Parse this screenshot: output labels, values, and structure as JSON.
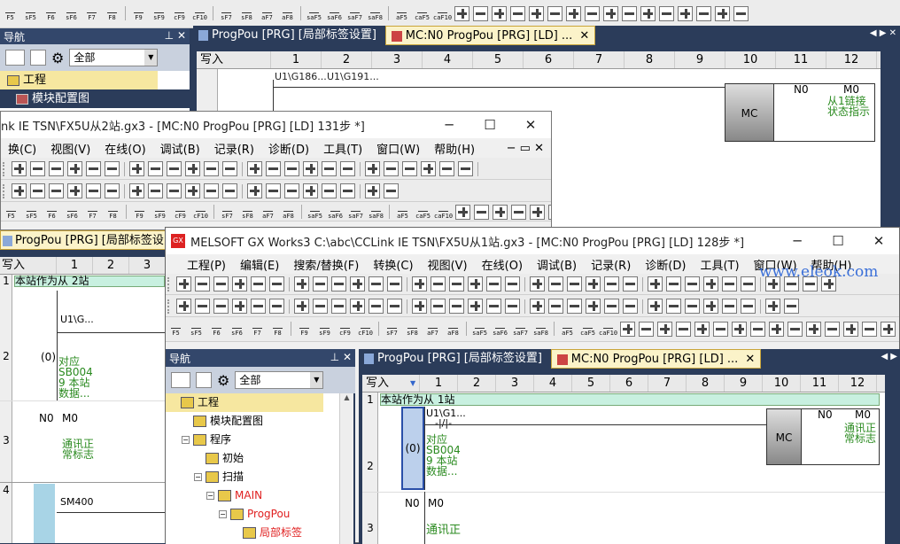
{
  "top_toolbar": {
    "labels": [
      "F5",
      "sF5",
      "F6",
      "sF6",
      "F7",
      "F8",
      "F9",
      "sF9",
      "cF9",
      "cF10",
      "sF7",
      "sF8",
      "aF7",
      "aF8",
      "saF5",
      "saF6",
      "saF7",
      "saF8",
      "aF5",
      "caF5",
      "caF10"
    ]
  },
  "back_nav": {
    "title": "导航",
    "select_value": "全部",
    "tree": [
      "工程",
      "模块配置图"
    ]
  },
  "back_tabs": [
    "ProgPou [PRG] [局部标签设置]",
    "MC:N0 ProgPou [PRG] [LD] ..."
  ],
  "back_ladder": {
    "write_mode": "写入",
    "columns": [
      "1",
      "2",
      "3",
      "4",
      "5",
      "6",
      "7",
      "8",
      "9",
      "10",
      "11",
      "12"
    ],
    "contacts": [
      "U1\\G186...",
      "U1\\G191..."
    ],
    "mc": "MC",
    "n0": "N0",
    "m0": "M0",
    "m0_comment": "从1链接\n状态指示",
    "row1": "1"
  },
  "mid_window": {
    "title": "nk IE TSN\\FX5U从2站.gx3 - [MC:N0 ProgPou [PRG] [LD] 131步 *]",
    "menus": [
      "换(C)",
      "视图(V)",
      "在线(O)",
      "调试(B)",
      "记录(R)",
      "诊断(D)",
      "工具(T)",
      "窗口(W)",
      "帮助(H)"
    ],
    "tab": "ProgPou [PRG] [局部标签设",
    "ladder": {
      "write_mode": "写入",
      "columns": [
        "1",
        "2",
        "3"
      ],
      "row1": "1",
      "row1_comment": "本站作为从 2站",
      "row2": "2",
      "step0": "(0)",
      "contact": "U1\\G...",
      "comment_row2": "对应\nSB004\n9 本站\n数据...",
      "row3": "3",
      "n0": "N0",
      "m0": "M0",
      "comment_row3": "通讯正\n常标志",
      "row4": "4",
      "sm400": "SM400"
    }
  },
  "front_window": {
    "title": "MELSOFT GX Works3 C:\\abc\\CCLink IE TSN\\FX5U从1站.gx3 - [MC:N0 ProgPou [PRG] [LD] 128步 *]",
    "menus": [
      "工程(P)",
      "编辑(E)",
      "搜索/替换(F)",
      "转换(C)",
      "视图(V)",
      "在线(O)",
      "调试(B)",
      "记录(R)",
      "诊断(D)",
      "工具(T)",
      "窗口(W)",
      "帮助(H)"
    ],
    "watermark": "www.eleok.com",
    "nav": {
      "title": "导航",
      "select_value": "全部",
      "tree": [
        {
          "label": "工程",
          "level": 0,
          "expander": "",
          "color": "#000"
        },
        {
          "label": "模块配置图",
          "level": 1,
          "expander": "",
          "color": "#000"
        },
        {
          "label": "程序",
          "level": 1,
          "expander": "−",
          "color": "#000"
        },
        {
          "label": "初始",
          "level": 2,
          "expander": "",
          "color": "#000"
        },
        {
          "label": "扫描",
          "level": 2,
          "expander": "−",
          "color": "#000"
        },
        {
          "label": "MAIN",
          "level": 3,
          "expander": "−",
          "color": "#e02020"
        },
        {
          "label": "ProgPou",
          "level": 4,
          "expander": "−",
          "color": "#e02020"
        },
        {
          "label": "局部标签",
          "level": 5,
          "expander": "",
          "color": "#e02020"
        }
      ]
    },
    "tabs": [
      "ProgPou [PRG] [局部标签设置]",
      "MC:N0 ProgPou [PRG] [LD] ..."
    ],
    "ladder": {
      "write_mode": "写入",
      "columns": [
        "1",
        "2",
        "3",
        "4",
        "5",
        "6",
        "7",
        "8",
        "9",
        "10",
        "11",
        "12"
      ],
      "row1": "1",
      "row1_comment": "本站作为从 1站",
      "row2": "2",
      "step0": "(0)",
      "contact": "U1\\G1...",
      "comment_row2": "对应\nSB004\n9 本站\n数据...",
      "mc": "MC",
      "n0": "N0",
      "m0": "M0",
      "m0_comment": "通讯正\n常标志",
      "n0_row3": "N0",
      "m0_row3": "M0",
      "row3": "3",
      "comment_row3": "通讯正"
    }
  }
}
